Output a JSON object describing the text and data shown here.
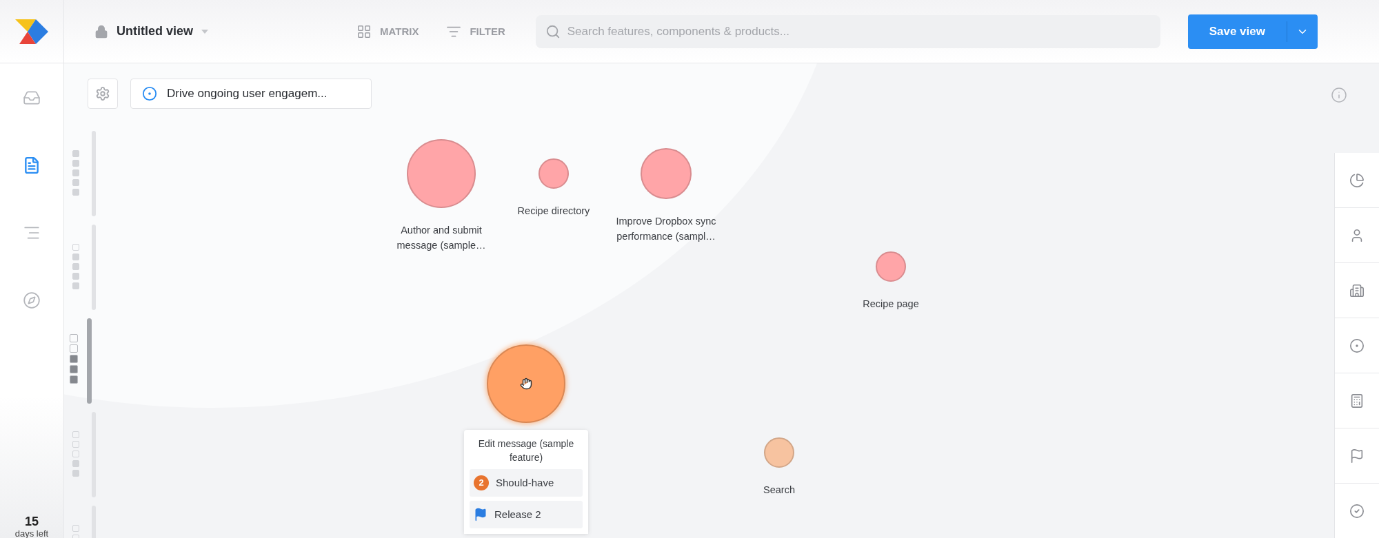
{
  "toolbar": {
    "view_title": "Untitled view",
    "matrix_label": "MATRIX",
    "filter_label": "FILTER",
    "search": {
      "placeholder": "Search features, components & products..."
    },
    "save_button": "Save view"
  },
  "nav": [
    {
      "kind": "inbox",
      "selected": false
    },
    {
      "kind": "document",
      "selected": true
    },
    {
      "kind": "lines",
      "selected": false
    },
    {
      "kind": "compass",
      "selected": false
    }
  ],
  "trial": {
    "count": "15",
    "label": "days left"
  },
  "goal": {
    "label": "Drive ongoing user engagem..."
  },
  "level_groups": [
    {
      "selected": false,
      "cells": [
        {
          "filled": true
        },
        {
          "filled": true
        },
        {
          "filled": true
        },
        {
          "filled": true
        },
        {
          "filled": true
        }
      ]
    },
    {
      "selected": false,
      "cells": [
        {
          "filled": false
        },
        {
          "filled": true
        },
        {
          "filled": true
        },
        {
          "filled": true
        },
        {
          "filled": true
        }
      ]
    },
    {
      "selected": true,
      "cells": [
        {
          "filled": false
        },
        {
          "filled": false
        },
        {
          "filled": true
        },
        {
          "filled": true
        },
        {
          "filled": true
        }
      ]
    },
    {
      "selected": false,
      "cells": [
        {
          "filled": false
        },
        {
          "filled": false
        },
        {
          "filled": false
        },
        {
          "filled": true
        },
        {
          "filled": true
        }
      ]
    },
    {
      "selected": false,
      "cells": [
        {
          "filled": false
        },
        {
          "filled": false
        }
      ]
    }
  ],
  "bubbles": [
    {
      "label": "Author and submit message (sample…",
      "color": "#ffa5a8",
      "selected": false
    },
    {
      "label": "Recipe directory",
      "color": "#ffa5a8",
      "selected": false
    },
    {
      "label": "Improve Dropbox sync performance (sampl…",
      "color": "#ffa5a8",
      "selected": false
    },
    {
      "label": "Recipe page",
      "color": "#ffa5a8",
      "selected": false
    },
    {
      "label": "Edit message (sample feature)",
      "color": "#ffa064",
      "selected": true,
      "details": {
        "priority_number": "2",
        "priority_label": "Should-have",
        "release": "Release 2"
      }
    },
    {
      "label": "Search",
      "color": "#f7c3a0",
      "selected": false
    }
  ],
  "right_rail": [
    {
      "kind": "pie"
    },
    {
      "kind": "person"
    },
    {
      "kind": "buildings"
    },
    {
      "kind": "target"
    },
    {
      "kind": "calculator"
    },
    {
      "kind": "flag"
    },
    {
      "kind": "check"
    }
  ]
}
